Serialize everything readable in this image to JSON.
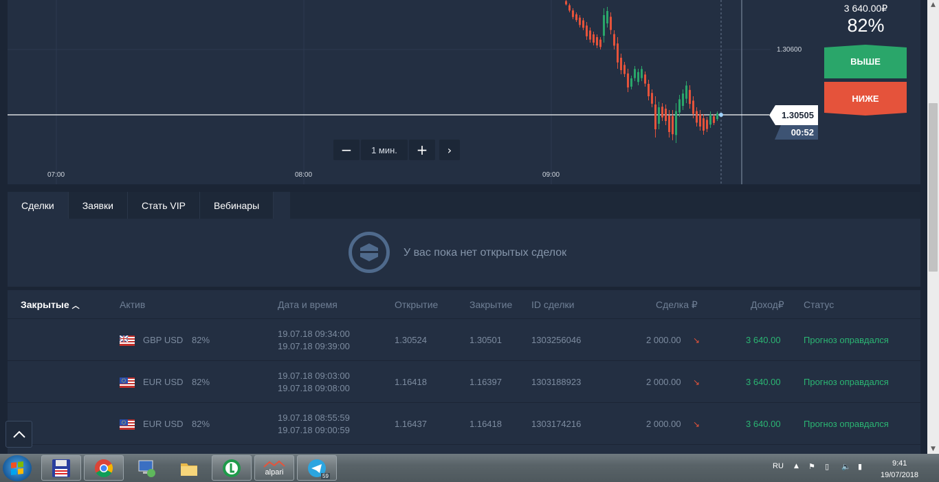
{
  "chart": {
    "y_tick": "1.30600",
    "x_ticks": [
      "07:00",
      "08:00",
      "09:00"
    ],
    "current_price": "1.30505",
    "timer": "00:52",
    "timeframe": "1 мин.",
    "zoom_out_symbol": "−",
    "zoom_in_symbol": "+",
    "next_symbol": "›",
    "colors": {
      "up": "#2aa66a",
      "down": "#e5533b",
      "background": "#232f42"
    }
  },
  "trade_panel": {
    "payout_amount": "3 640.00₽",
    "payout_percent": "82%",
    "up_label": "ВЫШЕ",
    "down_label": "НИЖЕ"
  },
  "tabs": [
    {
      "label": "Сделки",
      "active": true
    },
    {
      "label": "Заявки",
      "active": false
    },
    {
      "label": "Стать VIP",
      "active": false
    },
    {
      "label": "Вебинары",
      "active": false
    }
  ],
  "open_trades": {
    "empty_message": "У вас пока нет открытых сделок"
  },
  "closed_trades": {
    "title": "Закрытые",
    "title_icon": "chevron-up-icon",
    "columns": {
      "asset": "Актив",
      "datetime": "Дата и время",
      "open": "Открытие",
      "close": "Закрытие",
      "id": "ID сделки",
      "amount": "Сделка ₽",
      "income": "Доход₽",
      "status": "Статус"
    },
    "rows": [
      {
        "flag": "uk-us-flag-icon",
        "asset": "GBP USD",
        "payout": "82%",
        "start": "19.07.18 09:34:00",
        "end": "19.07.18 09:39:00",
        "open": "1.30524",
        "close": "1.30501",
        "id": "1303256046",
        "amount": "2 000.00",
        "direction_icon": "arrow-down-right-icon",
        "income": "3 640.00",
        "status": "Прогноз оправдался"
      },
      {
        "flag": "eu-us-flag-icon",
        "asset": "EUR USD",
        "payout": "82%",
        "start": "19.07.18 09:03:00",
        "end": "19.07.18 09:08:00",
        "open": "1.16418",
        "close": "1.16397",
        "id": "1303188923",
        "amount": "2 000.00",
        "direction_icon": "arrow-down-right-icon",
        "income": "3 640.00",
        "status": "Прогноз оправдался"
      },
      {
        "flag": "eu-us-flag-icon",
        "asset": "EUR USD",
        "payout": "82%",
        "start": "19.07.18 08:55:59",
        "end": "19.07.18 09:00:59",
        "open": "1.16437",
        "close": "1.16418",
        "id": "1303174216",
        "amount": "2 000.00",
        "direction_icon": "arrow-down-right-icon",
        "income": "3 640.00",
        "status": "Прогноз оправдался"
      }
    ]
  },
  "taskbar": {
    "apps": [
      "save-app-icon",
      "chrome-icon",
      "network-app-icon",
      "file-explorer-icon",
      "green-app-icon",
      "alpari-icon",
      "telegram-icon"
    ],
    "alpari_label": "alpari",
    "telegram_badge": "59",
    "language": "RU",
    "time": "9:41",
    "date": "19/07/2018"
  }
}
